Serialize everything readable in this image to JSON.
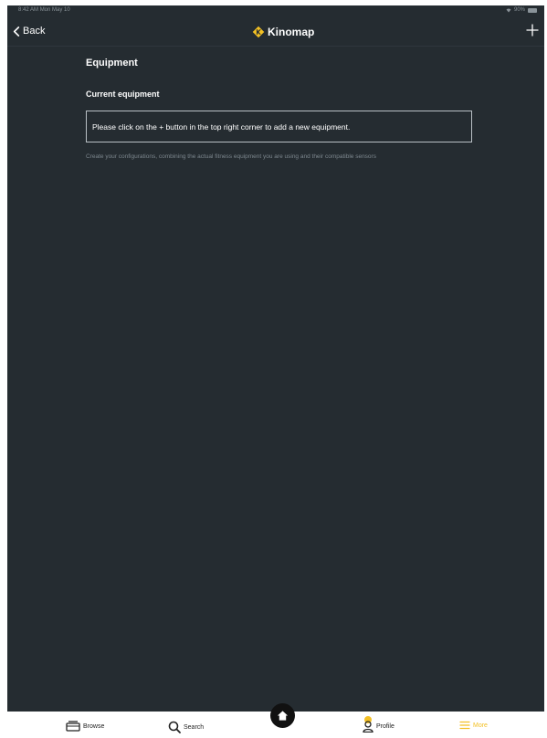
{
  "status_bar": {
    "time": "8:42 AM",
    "date": "Mon May 10",
    "battery": "90%"
  },
  "nav": {
    "back_label": "Back",
    "brand": "Kinomap"
  },
  "page": {
    "title": "Equipment",
    "section_title": "Current equipment",
    "empty_message": "Please click on the + button in the top right corner to add a new equipment.",
    "hint": "Create your configurations, combining the actual fitness equipment you are using and their compatible sensors"
  },
  "tabs": [
    {
      "label": "Browse",
      "icon": "browse-icon"
    },
    {
      "label": "Search",
      "icon": "search-icon"
    },
    {
      "label": "",
      "icon": "home-icon"
    },
    {
      "label": "Profile",
      "icon": "profile-icon"
    },
    {
      "label": "More",
      "icon": "menu-icon"
    }
  ],
  "colors": {
    "background": "#252c31",
    "accent": "#f3c024",
    "hint_text": "#7c868d"
  }
}
